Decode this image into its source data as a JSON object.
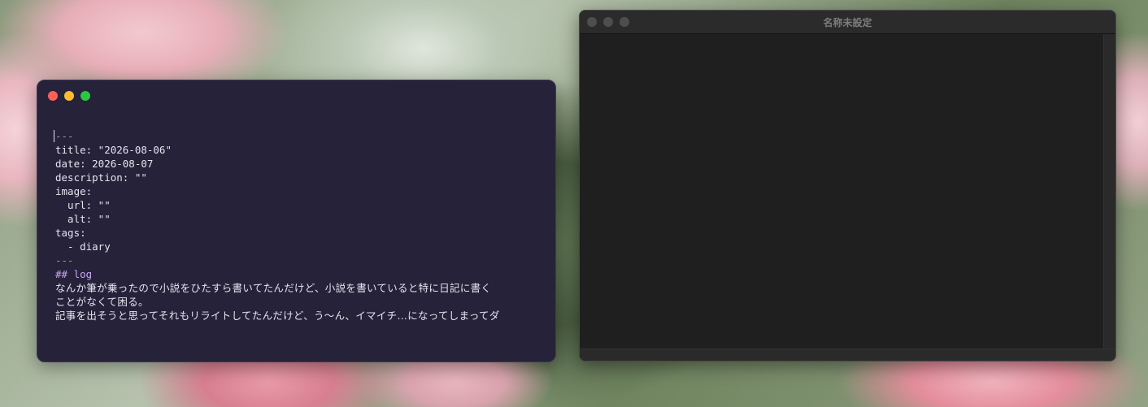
{
  "editor_window": {
    "lines": [
      "---",
      "title: \"2026-08-06\"",
      "date: 2026-08-07",
      "description: \"\"",
      "image:",
      "  url: \"\"",
      "  alt: \"\"",
      "tags:",
      "  - diary",
      "---",
      "## log",
      "なんか筆が乗ったので小説をひたすら書いてたんだけど、小説を書いていると特に日記に書く",
      "ことがなくて困る。",
      "記事を出そうと思ってそれもリライトしてたんだけど、う〜ん、イマイチ…になってしまってダ"
    ]
  },
  "blank_window": {
    "title": "名称未設定"
  },
  "colors": {
    "editor_bg": "#25223a",
    "heading": "#c8a6f5",
    "close": "#ff5f57",
    "minimize": "#febc2e",
    "zoom": "#28c840",
    "blank_bg": "#1f1f1f"
  }
}
